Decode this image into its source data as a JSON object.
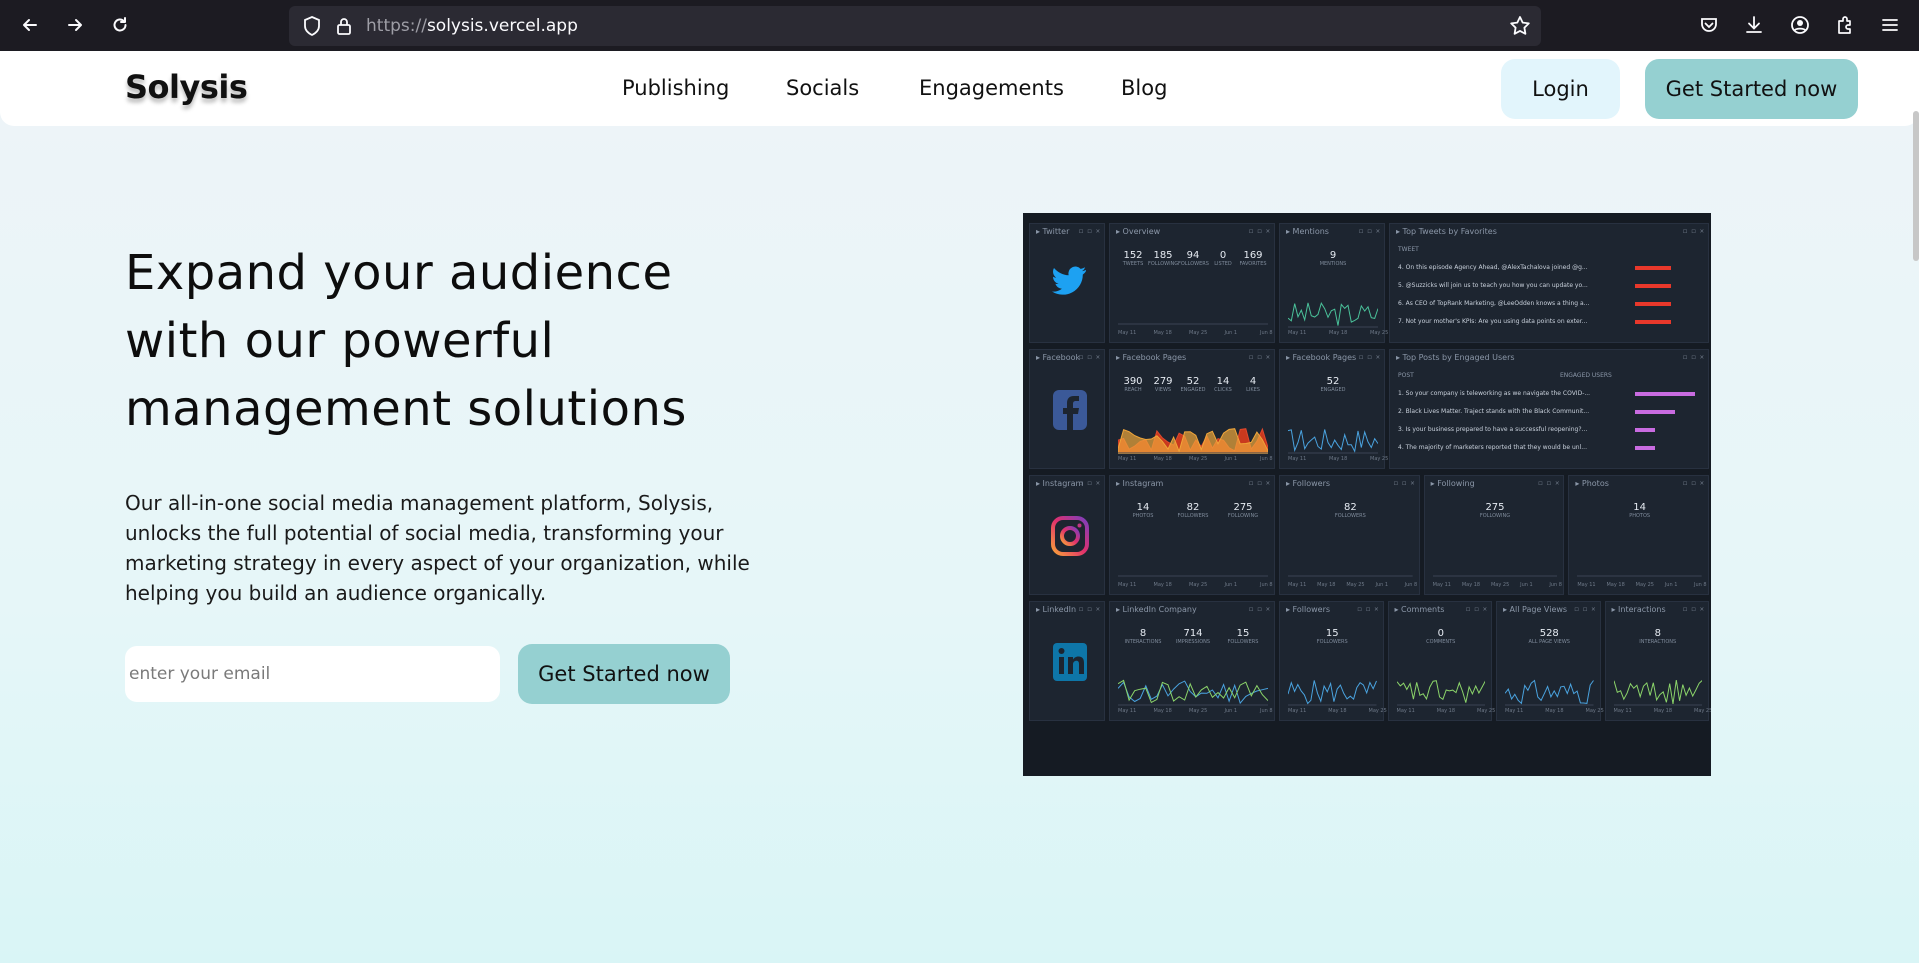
{
  "browser": {
    "url_scheme": "https://",
    "url_host": "solysis.vercel.app",
    "icons": [
      "back-icon",
      "forward-icon",
      "reload-icon",
      "shield-icon",
      "lock-icon",
      "bookmark-star-icon",
      "pocket-icon",
      "download-icon",
      "account-icon",
      "extensions-icon",
      "menu-icon"
    ]
  },
  "header": {
    "logo": "Solysis",
    "nav": [
      "Publishing",
      "Socials",
      "Engagements",
      "Blog"
    ],
    "login_label": "Login",
    "cta_label": "Get Started now"
  },
  "hero": {
    "title": "Expand your audience with our powerful management solutions",
    "subtitle": "Our all-in-one social media management platform, Solysis, unlocks the full potential of social media, transforming your marketing strategy in every aspect of your organization, while helping you build an audience organically.",
    "email_placeholder": "enter your email",
    "cta_label": "Get Started now"
  },
  "dashboard": {
    "rows": [
      {
        "network": "Twitter",
        "icon": "twitter-icon",
        "overview": {
          "title": "Overview",
          "stats": [
            [
              "152",
              "TWEETS"
            ],
            [
              "185",
              "FOLLOWING"
            ],
            [
              "94",
              "FOLLOWERS"
            ],
            [
              "0",
              "LISTED"
            ],
            [
              "169",
              "FAVORITES"
            ]
          ]
        },
        "second": {
          "title": "Mentions",
          "stats": [
            [
              "9",
              "MENTIONS"
            ]
          ]
        },
        "list": {
          "title": "Top Tweets by Favorites",
          "header": "TWEET",
          "items": [
            "On this episode Agency Ahead, @AlexTachalova joined @g...",
            "@Suzzicks will join us to teach you how you can update yo...",
            "As CEO of TopRank Marketing, @LeeOdden knows a thing a...",
            "Not your mother's KPIs: Are you using data points on exter..."
          ]
        }
      },
      {
        "network": "Facebook",
        "icon": "facebook-icon",
        "overview": {
          "title": "Facebook Pages",
          "stats": [
            [
              "390",
              "REACH"
            ],
            [
              "279",
              "VIEWS"
            ],
            [
              "52",
              "ENGAGED"
            ],
            [
              "14",
              "CLICKS"
            ],
            [
              "4",
              "LIKES"
            ]
          ]
        },
        "second": {
          "title": "Facebook Pages",
          "stats": [
            [
              "52",
              "ENGAGED"
            ]
          ]
        },
        "list": {
          "title": "Top Posts by Engaged Users",
          "header": "POST",
          "header2": "ENGAGED USERS",
          "items": [
            "So your company is teleworking as we navigate the COVID-...",
            "Black Lives Matter. Traject stands with the Black Communit...",
            "Is your business prepared to have a successful reopening?...",
            "The majority of marketers reported that they would be unl..."
          ]
        }
      },
      {
        "network": "Instagram",
        "icon": "instagram-icon",
        "overview": {
          "title": "Instagram",
          "stats": [
            [
              "14",
              "PHOTOS"
            ],
            [
              "82",
              "FOLLOWERS"
            ],
            [
              "275",
              "FOLLOWING"
            ]
          ]
        },
        "small": [
          {
            "title": "Followers",
            "value": "82",
            "label": "FOLLOWERS"
          },
          {
            "title": "Following",
            "value": "275",
            "label": "FOLLOWING"
          },
          {
            "title": "Photos",
            "value": "14",
            "label": "PHOTOS"
          }
        ]
      },
      {
        "network": "LinkedIn",
        "icon": "linkedin-icon",
        "overview": {
          "title": "LinkedIn Company",
          "stats": [
            [
              "8",
              "INTERACTIONS"
            ],
            [
              "714",
              "IMPRESSIONS"
            ],
            [
              "15",
              "FOLLOWERS"
            ]
          ]
        },
        "small": [
          {
            "title": "Followers",
            "value": "15",
            "label": "FOLLOWERS"
          },
          {
            "title": "Comments",
            "value": "0",
            "label": "COMMENTS"
          },
          {
            "title": "All Page Views",
            "value": "528",
            "label": "ALL PAGE VIEWS"
          },
          {
            "title": "Interactions",
            "value": "8",
            "label": "INTERACTIONS"
          }
        ]
      }
    ],
    "axis_labels": [
      "May 11",
      "May 18",
      "May 25",
      "Jun 1",
      "Jun 8"
    ]
  }
}
